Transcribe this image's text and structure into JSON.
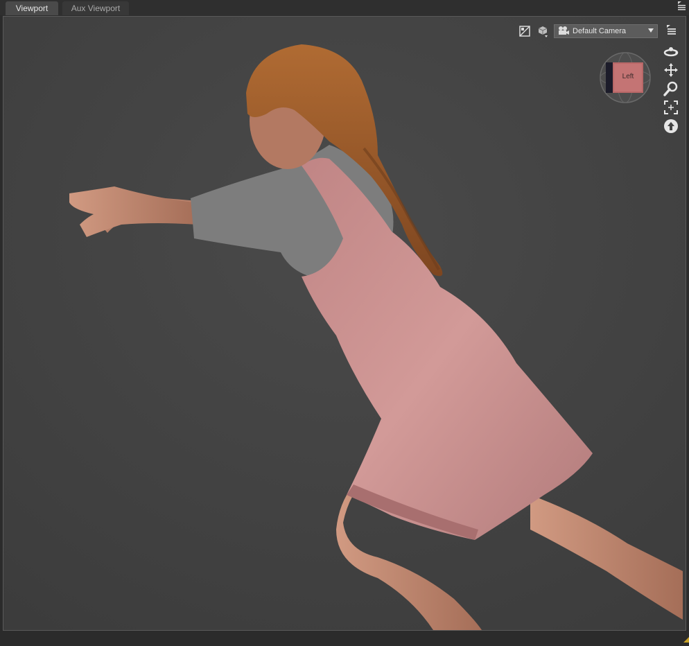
{
  "tabs": [
    {
      "label": "Viewport",
      "active": true
    },
    {
      "label": "Aux Viewport",
      "active": false
    }
  ],
  "camera": {
    "selected": "Default Camera"
  },
  "view_cube": {
    "face_label": "Left"
  },
  "icons": {
    "tab_menu": "panel-menu-icon",
    "render_preview": "render-preview-icon",
    "draw_style": "draw-style-cube-icon",
    "camera": "camera-icon",
    "dropdown": "chevron-down-icon",
    "viewport_menu": "viewport-menu-icon",
    "orbit": "orbit-icon",
    "pan": "pan-move-icon",
    "zoom": "zoom-magnifier-icon",
    "frame": "frame-selection-icon",
    "reset": "reset-view-icon"
  },
  "colors": {
    "viewport_bg": "#444444",
    "dress": "#c98f8f",
    "shirt": "#7b7b7b",
    "skin": "#c38a72",
    "hair": "#9a5a2a"
  }
}
